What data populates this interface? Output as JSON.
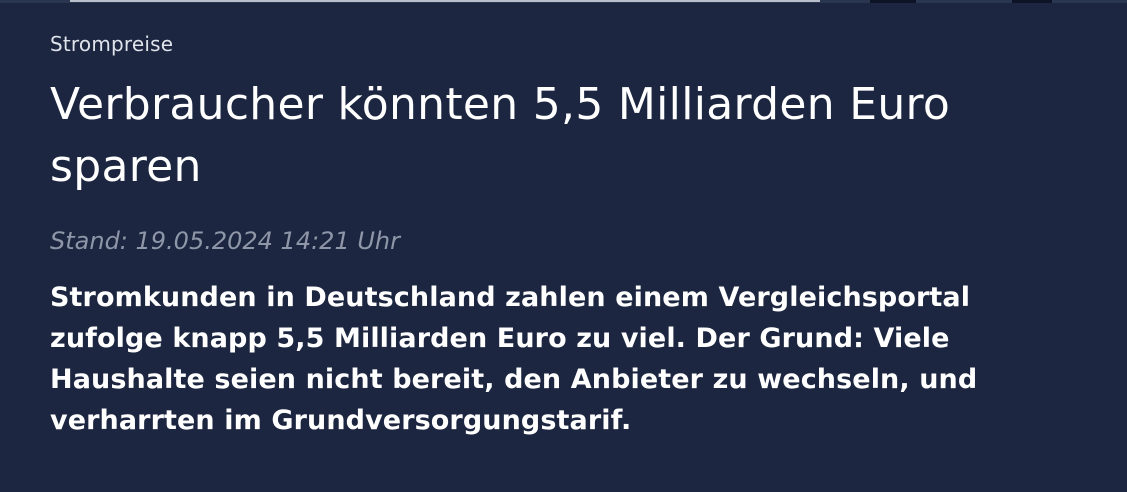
{
  "article": {
    "topline": "Strompreise",
    "headline": "Verbraucher könnten 5,5 Milliarden Euro sparen",
    "dateline": "Stand: 19.05.2024 14:21 Uhr",
    "lead": "Stromkunden in Deutschland zahlen einem Vergleichsportal zufolge knapp 5,5 Milliarden Euro zu viel. Der Grund: Viele Haushalte seien nicht bereit, den Anbieter zu wechseln, und verharrten im Grundversorgungstarif."
  },
  "colors": {
    "background": "#1c2640",
    "text": "#ffffff",
    "dateline": "#8e96a8"
  }
}
